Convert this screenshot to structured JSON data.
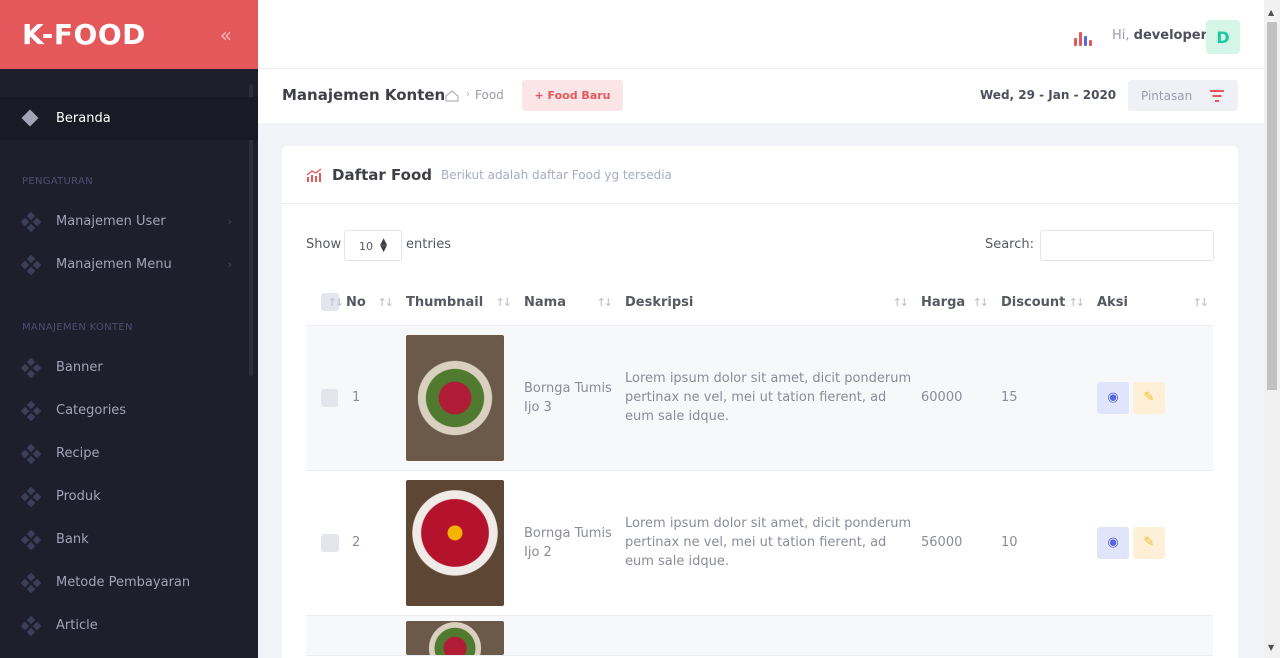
{
  "brand": {
    "title": "K-FOOD",
    "toggle": "«"
  },
  "sidebar": {
    "home": "Beranda",
    "section_settings": "PENGATURAN",
    "settings_items": [
      {
        "label": "Manajemen User",
        "arrow": "›"
      },
      {
        "label": "Manajemen Menu",
        "arrow": "›"
      }
    ],
    "section_content": "MANAJEMEN KONTEN",
    "content_items": [
      "Banner",
      "Categories",
      "Recipe",
      "Produk",
      "Bank",
      "Metode Pembayaran",
      "Article"
    ]
  },
  "header": {
    "greeting": "Hi,",
    "username": "developer",
    "avatar_letter": "D"
  },
  "subheader": {
    "title": "Manajemen Konten",
    "breadcrumb_sep": "›",
    "breadcrumb_item": "Food",
    "new_button": "+ Food Baru",
    "date": "Wed, 29 - Jan - 2020",
    "shortcut_button": "Pintasan"
  },
  "card": {
    "title": "Daftar Food",
    "description": "Berikut adalah daftar Food yg tersedia",
    "show_label": "Show",
    "length_value": "10",
    "entries_label": "entries",
    "search_label": "Search:",
    "search_value": ""
  },
  "table": {
    "columns": [
      "No",
      "Thumbnail",
      "Nama",
      "Deskripsi",
      "Harga",
      "Discount",
      "Aksi"
    ],
    "sort_glyph": "↑↓",
    "rows": [
      {
        "no": "1",
        "nama": "Bornga Tumis Ijo 3",
        "deskripsi": "Lorem ipsum dolor sit amet, dicit ponderum pertinax ne vel, mei ut tation fierent, ad eum sale idque.",
        "harga": "60000",
        "discount": "15"
      },
      {
        "no": "2",
        "nama": "Bornga Tumis Ijo 2",
        "deskripsi": "Lorem ipsum dolor sit amet, dicit ponderum pertinax ne vel, mei ut tation fierent, ad eum sale idque.",
        "harga": "56000",
        "discount": "10"
      }
    ]
  },
  "colors": {
    "accent": "#e4575b",
    "sidebar_bg": "#1e1e2d",
    "avatar_text": "#1dc9a0"
  },
  "icons": [
    "chevron-double-left-icon",
    "diamond-icon",
    "grid-dots-icon",
    "bar-chart-icon",
    "home-icon",
    "filter-icon",
    "chart-line-icon",
    "sort-icon",
    "eye-icon",
    "edit-icon"
  ]
}
